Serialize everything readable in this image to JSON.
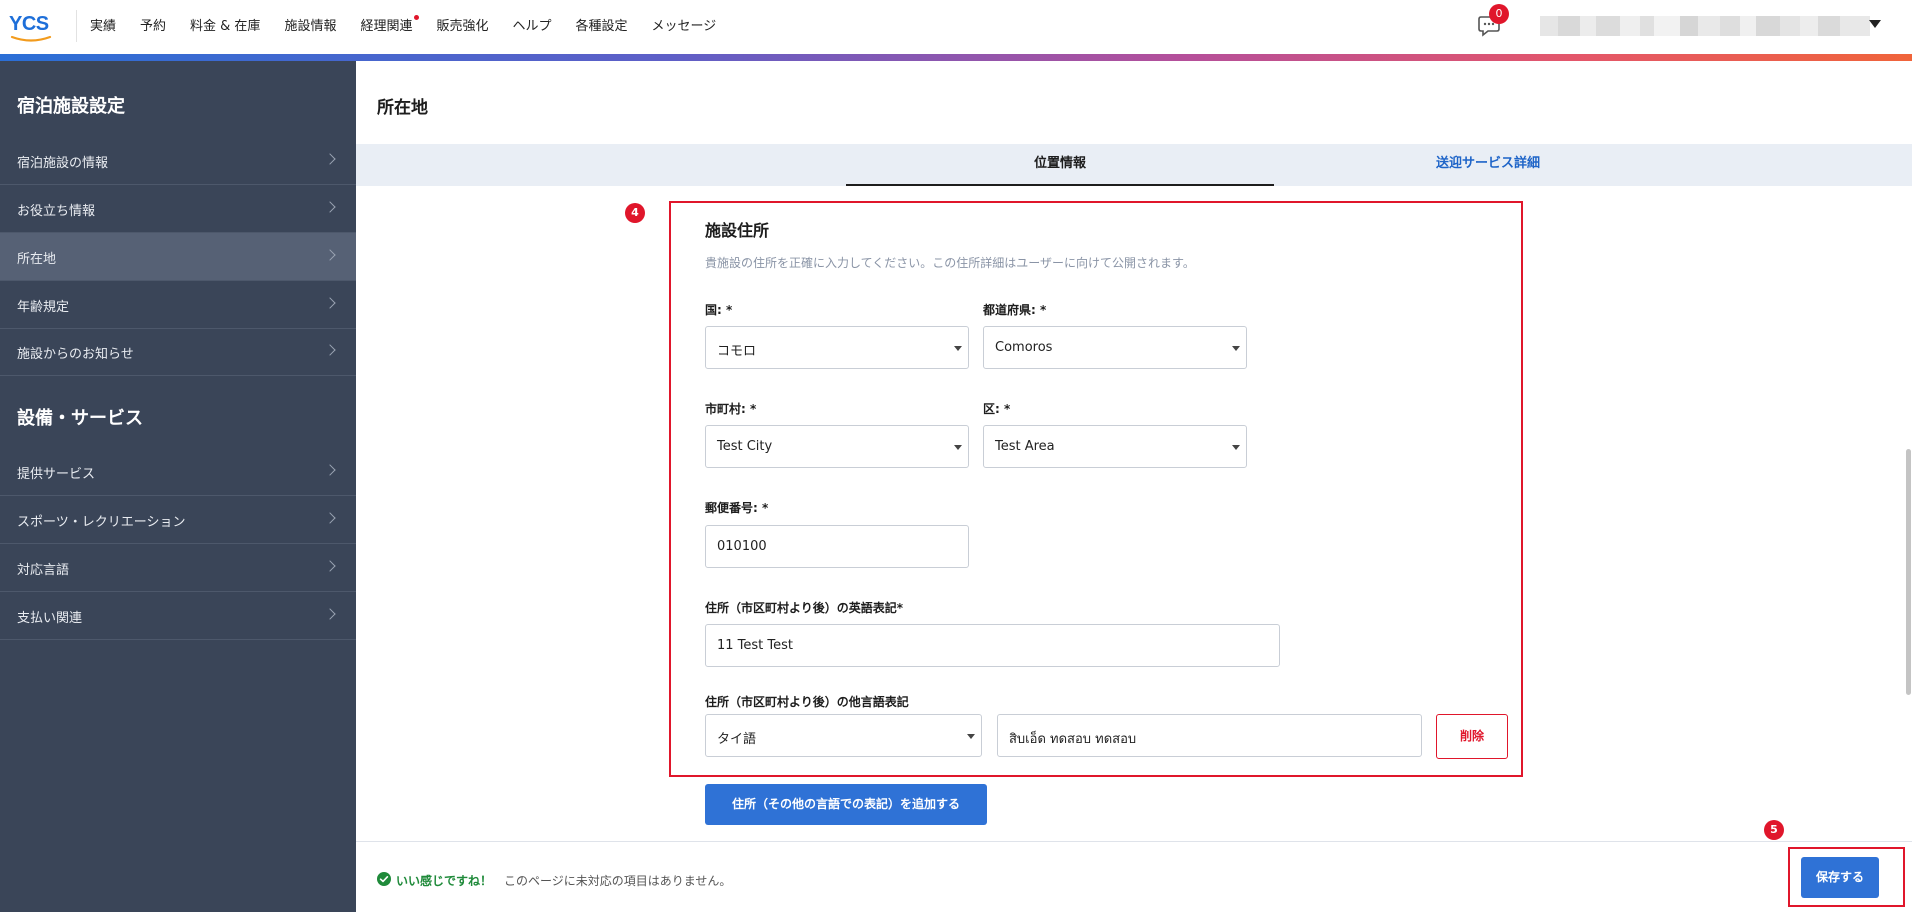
{
  "header": {
    "logo_text": "YCS",
    "nav": [
      {
        "label": "実績"
      },
      {
        "label": "予約"
      },
      {
        "label": "料金 & 在庫"
      },
      {
        "label": "施設情報"
      },
      {
        "label": "経理関連"
      },
      {
        "label": "販売強化"
      },
      {
        "label": "ヘルプ"
      },
      {
        "label": "各種設定"
      },
      {
        "label": "メッセージ"
      }
    ],
    "message_badge_count": "0",
    "accent_gradient": [
      "#2b6fd6",
      "#b54f9a",
      "#f0643a"
    ]
  },
  "sidebar": {
    "heading_1": "宿泊施設設定",
    "group_1": [
      {
        "label": "宿泊施設の情報",
        "active": false
      },
      {
        "label": "お役立ち情報",
        "active": false
      },
      {
        "label": "所在地",
        "active": true
      },
      {
        "label": "年齢規定",
        "active": false
      },
      {
        "label": "施設からのお知らせ",
        "active": false
      }
    ],
    "heading_2": "設備・サービス",
    "group_2": [
      {
        "label": "提供サービス"
      },
      {
        "label": "スポーツ・レクリエーション"
      },
      {
        "label": "対応言語"
      },
      {
        "label": "支払い関連"
      }
    ]
  },
  "main": {
    "page_title": "所在地",
    "tabs": [
      {
        "label": "位置情報",
        "active": true
      },
      {
        "label": "送迎サービス詳細",
        "active": false
      }
    ],
    "annotation_markers": [
      "4",
      "5"
    ],
    "section": {
      "title": "施設住所",
      "description": "貴施設の住所を正確に入力してください。この住所詳細はユーザーに向けて公開されます。",
      "country": {
        "label": "国: *",
        "value": "コモロ"
      },
      "prefecture": {
        "label": "都道府県: *",
        "value": "Comoros"
      },
      "city": {
        "label": "市町村: *",
        "value": "Test City"
      },
      "area": {
        "label": "区: *",
        "value": "Test Area"
      },
      "postal": {
        "label": "郵便番号: *",
        "value": "010100"
      },
      "address_en": {
        "label": "住所（市区町村より後）の英語表記*",
        "value": "11 Test Test"
      },
      "address_other": {
        "label": "住所（市区町村より後）の他言語表記",
        "language": "タイ語",
        "value": "สิบเอ็ด ทดสอบ ทดสอบ",
        "delete_label": "削除"
      },
      "add_button": "住所（その他の言語での表記）を追加する"
    }
  },
  "footer": {
    "good_label": "いい感じですね！",
    "message": "このページに未対応の項目はありません。",
    "save_button": "保存する"
  },
  "colors": {
    "primary": "#2f72d6",
    "danger": "#e0162b",
    "success": "#1f8a3a",
    "sidebar_bg": "#3a4558"
  }
}
